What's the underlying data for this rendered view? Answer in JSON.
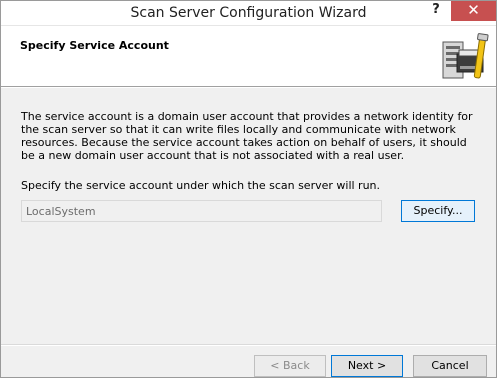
{
  "window": {
    "title": "Scan Server Configuration Wizard",
    "help_label": "?",
    "close_label": "✕",
    "accent_color": "#c75050"
  },
  "header": {
    "title": "Specify Service Account",
    "art_icon": "scanner-server-icon"
  },
  "body": {
    "description": "The service account is a domain user account that provides a network identity for the scan server so that it can write files locally and communicate with network resources. Because the service account takes action on behalf of users, it should be a new domain user account that is not associated with a real user.",
    "prompt": "Specify the service account under which the scan server will run.",
    "account_value": "LocalSystem",
    "specify_label": "Specify..."
  },
  "footer": {
    "back_label": "< Back",
    "next_label": "Next >",
    "cancel_label": "Cancel"
  }
}
